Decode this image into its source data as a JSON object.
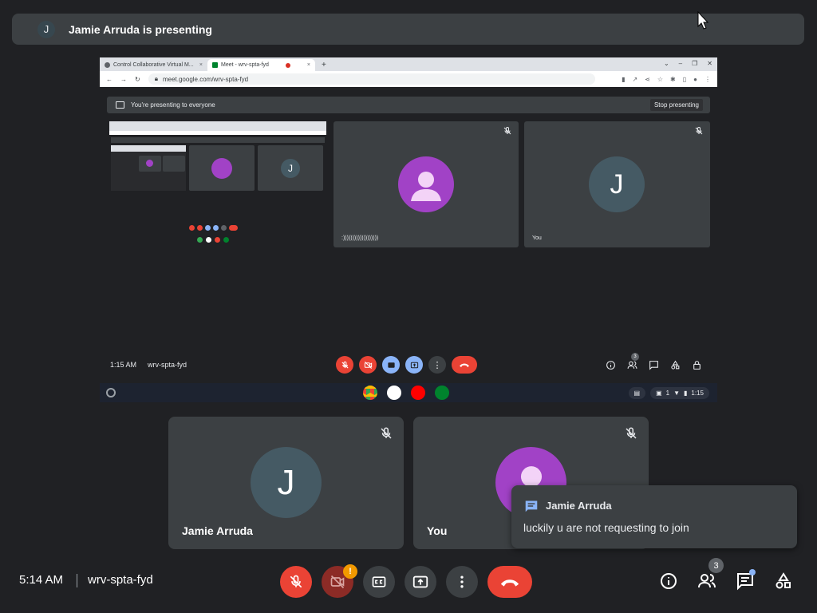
{
  "banner": {
    "avatar_letter": "J",
    "text": "Jamie Arruda is presenting"
  },
  "shared_screen": {
    "tabs": [
      {
        "label": "Control Collaborative Virtual M...",
        "close": "×"
      },
      {
        "label": "Meet - wrv-spta-fyd",
        "close": "×"
      }
    ],
    "new_tab": "+",
    "url": "meet.google.com/wrv-spta-fyd",
    "present_banner": {
      "text": "You're presenting to everyone",
      "stop_label": "Stop presenting"
    },
    "tiles": [
      {
        "name": ":)))))))))))))))))))",
        "avatar": "purple-person"
      },
      {
        "name": "You",
        "avatar_letter": "J"
      }
    ],
    "meeting_bar": {
      "time": "1:15 AM",
      "code": "wrv-spta-fyd",
      "people_count": "3"
    },
    "shelf": {
      "clock": "1:15",
      "notif_count": "1"
    }
  },
  "participants": [
    {
      "name": "Jamie Arruda",
      "avatar_letter": "J",
      "avatar_color": "#455a64"
    },
    {
      "name": "You",
      "avatar_color": "#a142c6"
    }
  ],
  "chat_toast": {
    "sender": "Jamie Arruda",
    "message": "luckily u are not requesting to join"
  },
  "bottom_bar": {
    "time": "5:14 AM",
    "meeting_code": "wrv-spta-fyd",
    "camera_warning": "!",
    "people_count": "3"
  },
  "colors": {
    "background": "#202124",
    "tile": "#3c4043",
    "danger": "#ea4335",
    "accent": "#8ab4f8",
    "warning": "#f29900"
  }
}
